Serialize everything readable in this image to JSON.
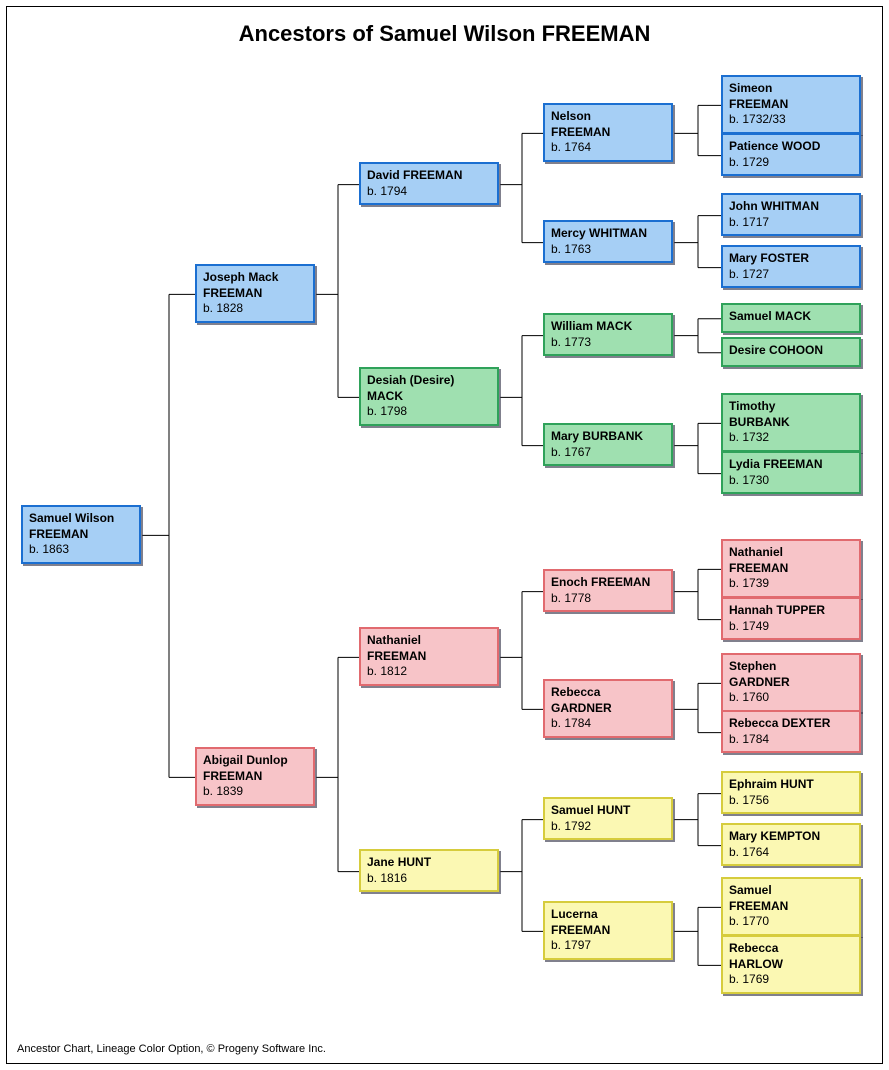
{
  "title": "Ancestors of Samuel Wilson FREEMAN",
  "footer": "Ancestor Chart, Lineage Color Option, © Progeny Software Inc.",
  "people": {
    "g0": {
      "first": "Samuel Wilson",
      "last": "FREEMAN",
      "born": "b. 1863"
    },
    "g1a": {
      "first": "Joseph Mack",
      "last": "FREEMAN",
      "born": "b. 1828"
    },
    "g1b": {
      "first": "Abigail Dunlop",
      "last": "FREEMAN",
      "born": "b. 1839"
    },
    "g2a": {
      "first": "David",
      "last": "FREEMAN",
      "born": "b. 1794"
    },
    "g2b": {
      "first": "Desiah (Desire)",
      "last": "MACK",
      "born": "b. 1798"
    },
    "g2c": {
      "first": "Nathaniel",
      "last": "FREEMAN",
      "born": "b. 1812"
    },
    "g2d": {
      "first": "Jane",
      "last": "HUNT",
      "born": "b. 1816"
    },
    "g3a": {
      "first": "Nelson",
      "last": "FREEMAN",
      "born": "b. 1764"
    },
    "g3b": {
      "first": "Mercy",
      "last": "WHITMAN",
      "born": "b. 1763"
    },
    "g3c": {
      "first": "William",
      "last": "MACK",
      "born": "b. 1773"
    },
    "g3d": {
      "first": "Mary",
      "last": "BURBANK",
      "born": "b. 1767"
    },
    "g3e": {
      "first": "Enoch",
      "last": "FREEMAN",
      "born": "b. 1778"
    },
    "g3f": {
      "first": "Rebecca",
      "last": "GARDNER",
      "born": "b. 1784"
    },
    "g3g": {
      "first": "Samuel",
      "last": "HUNT",
      "born": "b. 1792"
    },
    "g3h": {
      "first": "Lucerna",
      "last": "FREEMAN",
      "born": "b. 1797"
    },
    "g4a": {
      "first": "Simeon",
      "last": "FREEMAN",
      "born": "b. 1732/33"
    },
    "g4b": {
      "first": "Patience",
      "last": "WOOD",
      "born": "b. 1729"
    },
    "g4c": {
      "first": "John",
      "last": "WHITMAN",
      "born": "b. 1717"
    },
    "g4d": {
      "first": "Mary",
      "last": "FOSTER",
      "born": "b. 1727"
    },
    "g4e": {
      "first": "Samuel",
      "last": "MACK",
      "born": ""
    },
    "g4f": {
      "first": "Desire",
      "last": "COHOON",
      "born": ""
    },
    "g4g": {
      "first": "Timothy",
      "last": "BURBANK",
      "born": "b. 1732"
    },
    "g4h": {
      "first": "Lydia",
      "last": "FREEMAN",
      "born": "b. 1730"
    },
    "g4i": {
      "first": "Nathaniel",
      "last": "FREEMAN",
      "born": "b. 1739"
    },
    "g4j": {
      "first": "Hannah",
      "last": "TUPPER",
      "born": "b. 1749"
    },
    "g4k": {
      "first": "Stephen",
      "last": "GARDNER",
      "born": "b. 1760"
    },
    "g4l": {
      "first": "Rebecca",
      "last": "DEXTER",
      "born": "b. 1784"
    },
    "g4m": {
      "first": "Ephraim",
      "last": "HUNT",
      "born": "b. 1756"
    },
    "g4n": {
      "first": "Mary",
      "last": "KEMPTON",
      "born": "b. 1764"
    },
    "g4o": {
      "first": "Samuel",
      "last": "FREEMAN",
      "born": "b. 1770"
    },
    "g4p": {
      "first": "Rebecca",
      "last": "HARLOW",
      "born": "b. 1769"
    }
  }
}
